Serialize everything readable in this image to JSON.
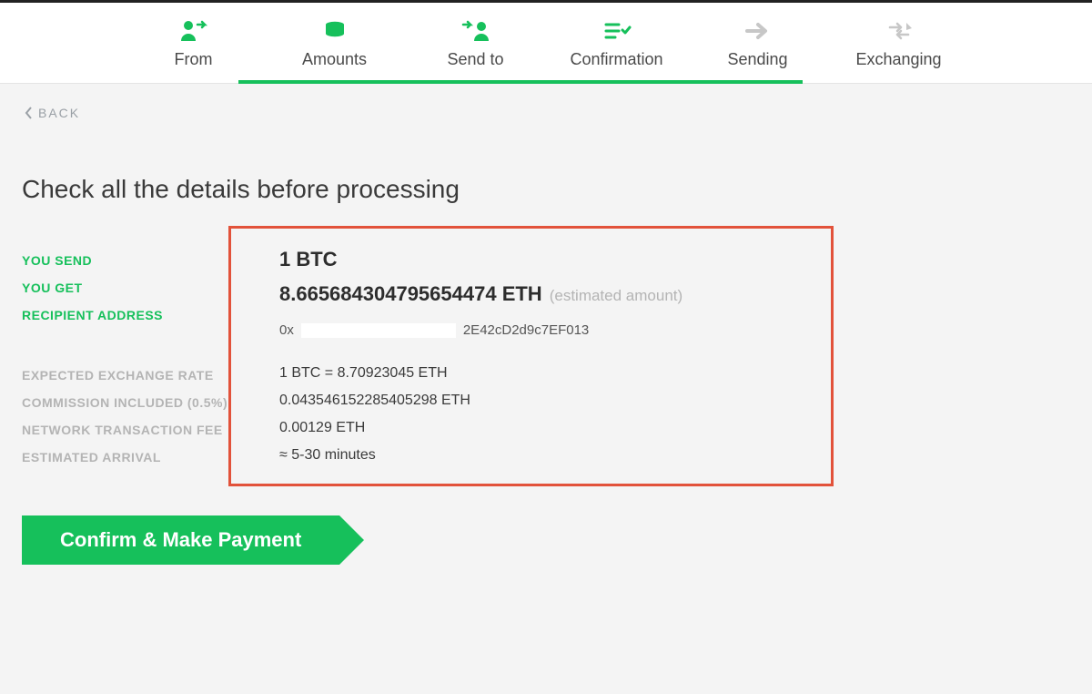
{
  "steps": {
    "from": {
      "label": "From"
    },
    "amounts": {
      "label": "Amounts"
    },
    "sendto": {
      "label": "Send to"
    },
    "confirmation": {
      "label": "Confirmation"
    },
    "sending": {
      "label": "Sending"
    },
    "exchanging": {
      "label": "Exchanging"
    }
  },
  "back_label": "BACK",
  "page_title": "Check all the details before processing",
  "labels": {
    "you_send": "YOU SEND",
    "you_get": "YOU GET",
    "recipient_address": "RECIPIENT ADDRESS",
    "expected_rate": "EXPECTED EXCHANGE RATE",
    "commission": "COMMISSION INCLUDED (0.5%)",
    "network_fee": "NETWORK TRANSACTION FEE",
    "arrival": "ESTIMATED ARRIVAL"
  },
  "values": {
    "you_send": "1 BTC",
    "you_get": "8.665684304795654474 ETH",
    "you_get_note": "(estimated amount)",
    "address_prefix": "0x",
    "address_mid": "2E42cD2d9c7EF013",
    "expected_rate": "1 BTC = 8.70923045 ETH",
    "commission": "0.043546152285405298 ETH",
    "network_fee": "0.00129 ETH",
    "arrival": "≈ 5-30 minutes"
  },
  "cta_label": "Confirm & Make Payment"
}
